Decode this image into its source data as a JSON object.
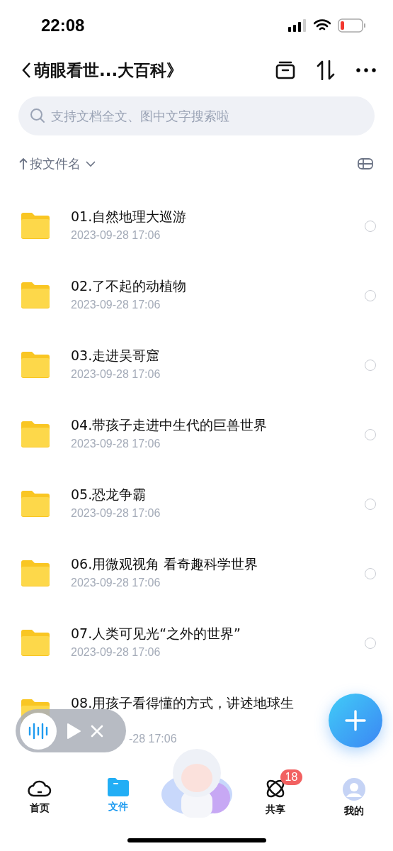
{
  "status_bar": {
    "time": "22:08"
  },
  "header": {
    "title": "萌眼看世...大百科》"
  },
  "search": {
    "placeholder": "支持文档全文、图中文字搜索啦"
  },
  "sort": {
    "label": "按文件名"
  },
  "files": [
    {
      "name": "01.自然地理大巡游",
      "date": "2023-09-28 17:06",
      "selected": false
    },
    {
      "name": "02.了不起的动植物",
      "date": "2023-09-28 17:06",
      "selected": false
    },
    {
      "name": "03.走进吴哥窟",
      "date": "2023-09-28 17:06",
      "selected": false
    },
    {
      "name": "04.带孩子走进中生代的巨兽世界",
      "date": "2023-09-28 17:06",
      "selected": false
    },
    {
      "name": "05.恐龙争霸",
      "date": "2023-09-28 17:06",
      "selected": false
    },
    {
      "name": "06.用微观视角 看奇趣科学世界",
      "date": "2023-09-28 17:06",
      "selected": false
    },
    {
      "name": "07.人类可见光“之外的世界”",
      "date": "2023-09-28 17:06",
      "selected": false
    },
    {
      "name": "08.用孩子看得懂的方式，讲述地球生",
      "date": "-28 17:06",
      "kind": "under_player"
    }
  ],
  "nav": [
    {
      "kind": "home",
      "label": "首页",
      "selected": false
    },
    {
      "kind": "files",
      "label": "文件",
      "selected": true
    },
    {
      "kind": "mascot"
    },
    {
      "kind": "share",
      "label": "共享",
      "selected": false,
      "badge": "18"
    },
    {
      "kind": "me",
      "label": "我的",
      "selected": false
    }
  ]
}
